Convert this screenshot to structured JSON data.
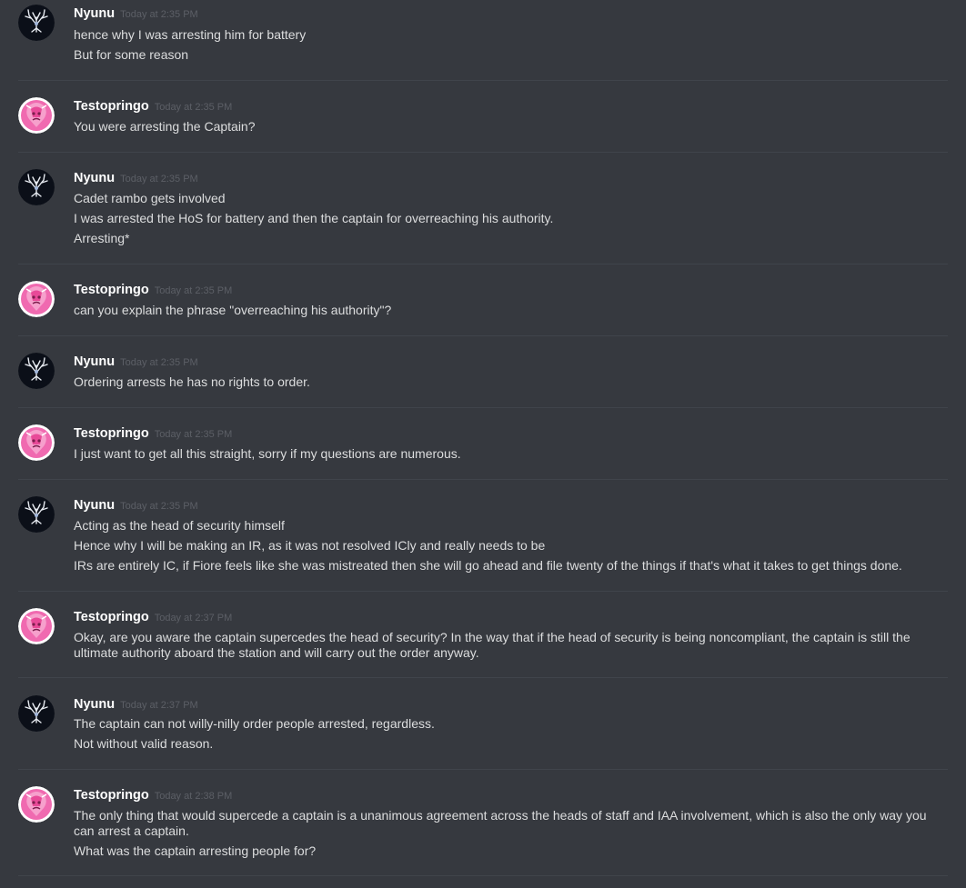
{
  "users": {
    "nyunu": {
      "name": "Nyunu",
      "avatar_icon": "dark-antler-emblem-avatar",
      "accent": "#0b0f18"
    },
    "testo": {
      "name": "Testopringo",
      "avatar_icon": "pink-gem-avatar",
      "accent": "#f06ab0"
    }
  },
  "messages": [
    {
      "author": "Nyunu",
      "timestamp": "Today at 2:35 PM",
      "lines": [
        "hence why I was arresting him for battery",
        "But for some reason"
      ]
    },
    {
      "author": "Testopringo",
      "timestamp": "Today at 2:35 PM",
      "lines": [
        "You were arresting the Captain?"
      ]
    },
    {
      "author": "Nyunu",
      "timestamp": "Today at 2:35 PM",
      "lines": [
        "Cadet rambo gets involved",
        "I was arrested the HoS for battery and then the captain for overreaching his authority.",
        "Arresting*"
      ]
    },
    {
      "author": "Testopringo",
      "timestamp": "Today at 2:35 PM",
      "lines": [
        "can you explain the phrase \"overreaching his authority\"?"
      ]
    },
    {
      "author": "Nyunu",
      "timestamp": "Today at 2:35 PM",
      "lines": [
        "Ordering arrests he has no rights to order."
      ]
    },
    {
      "author": "Testopringo",
      "timestamp": "Today at 2:35 PM",
      "lines": [
        "I just want to get all this straight, sorry if my questions are numerous."
      ]
    },
    {
      "author": "Nyunu",
      "timestamp": "Today at 2:35 PM",
      "lines": [
        "Acting as the head of security himself",
        "Hence why I will be making an IR, as it was not resolved ICly and really needs to be",
        "IRs are entirely IC, if Fiore feels like she was mistreated then she will go ahead and file twenty of the things if that's what it takes to get things done."
      ]
    },
    {
      "author": "Testopringo",
      "timestamp": "Today at 2:37 PM",
      "lines": [
        "Okay, are you aware the captain supercedes the head of security? In the way that if the head of security is being noncompliant, the captain is still the ultimate authority aboard the station and will carry out the order anyway."
      ]
    },
    {
      "author": "Nyunu",
      "timestamp": "Today at 2:37 PM",
      "lines": [
        "The captain can not willy-nilly order people arrested, regardless.",
        "Not without valid reason."
      ]
    },
    {
      "author": "Testopringo",
      "timestamp": "Today at 2:38 PM",
      "lines": [
        "The only thing that would supercede a captain is a unanimous agreement across the heads of staff and IAA involvement, which is also the only way you can arrest a captain.",
        "What was the captain arresting people for?"
      ]
    }
  ]
}
